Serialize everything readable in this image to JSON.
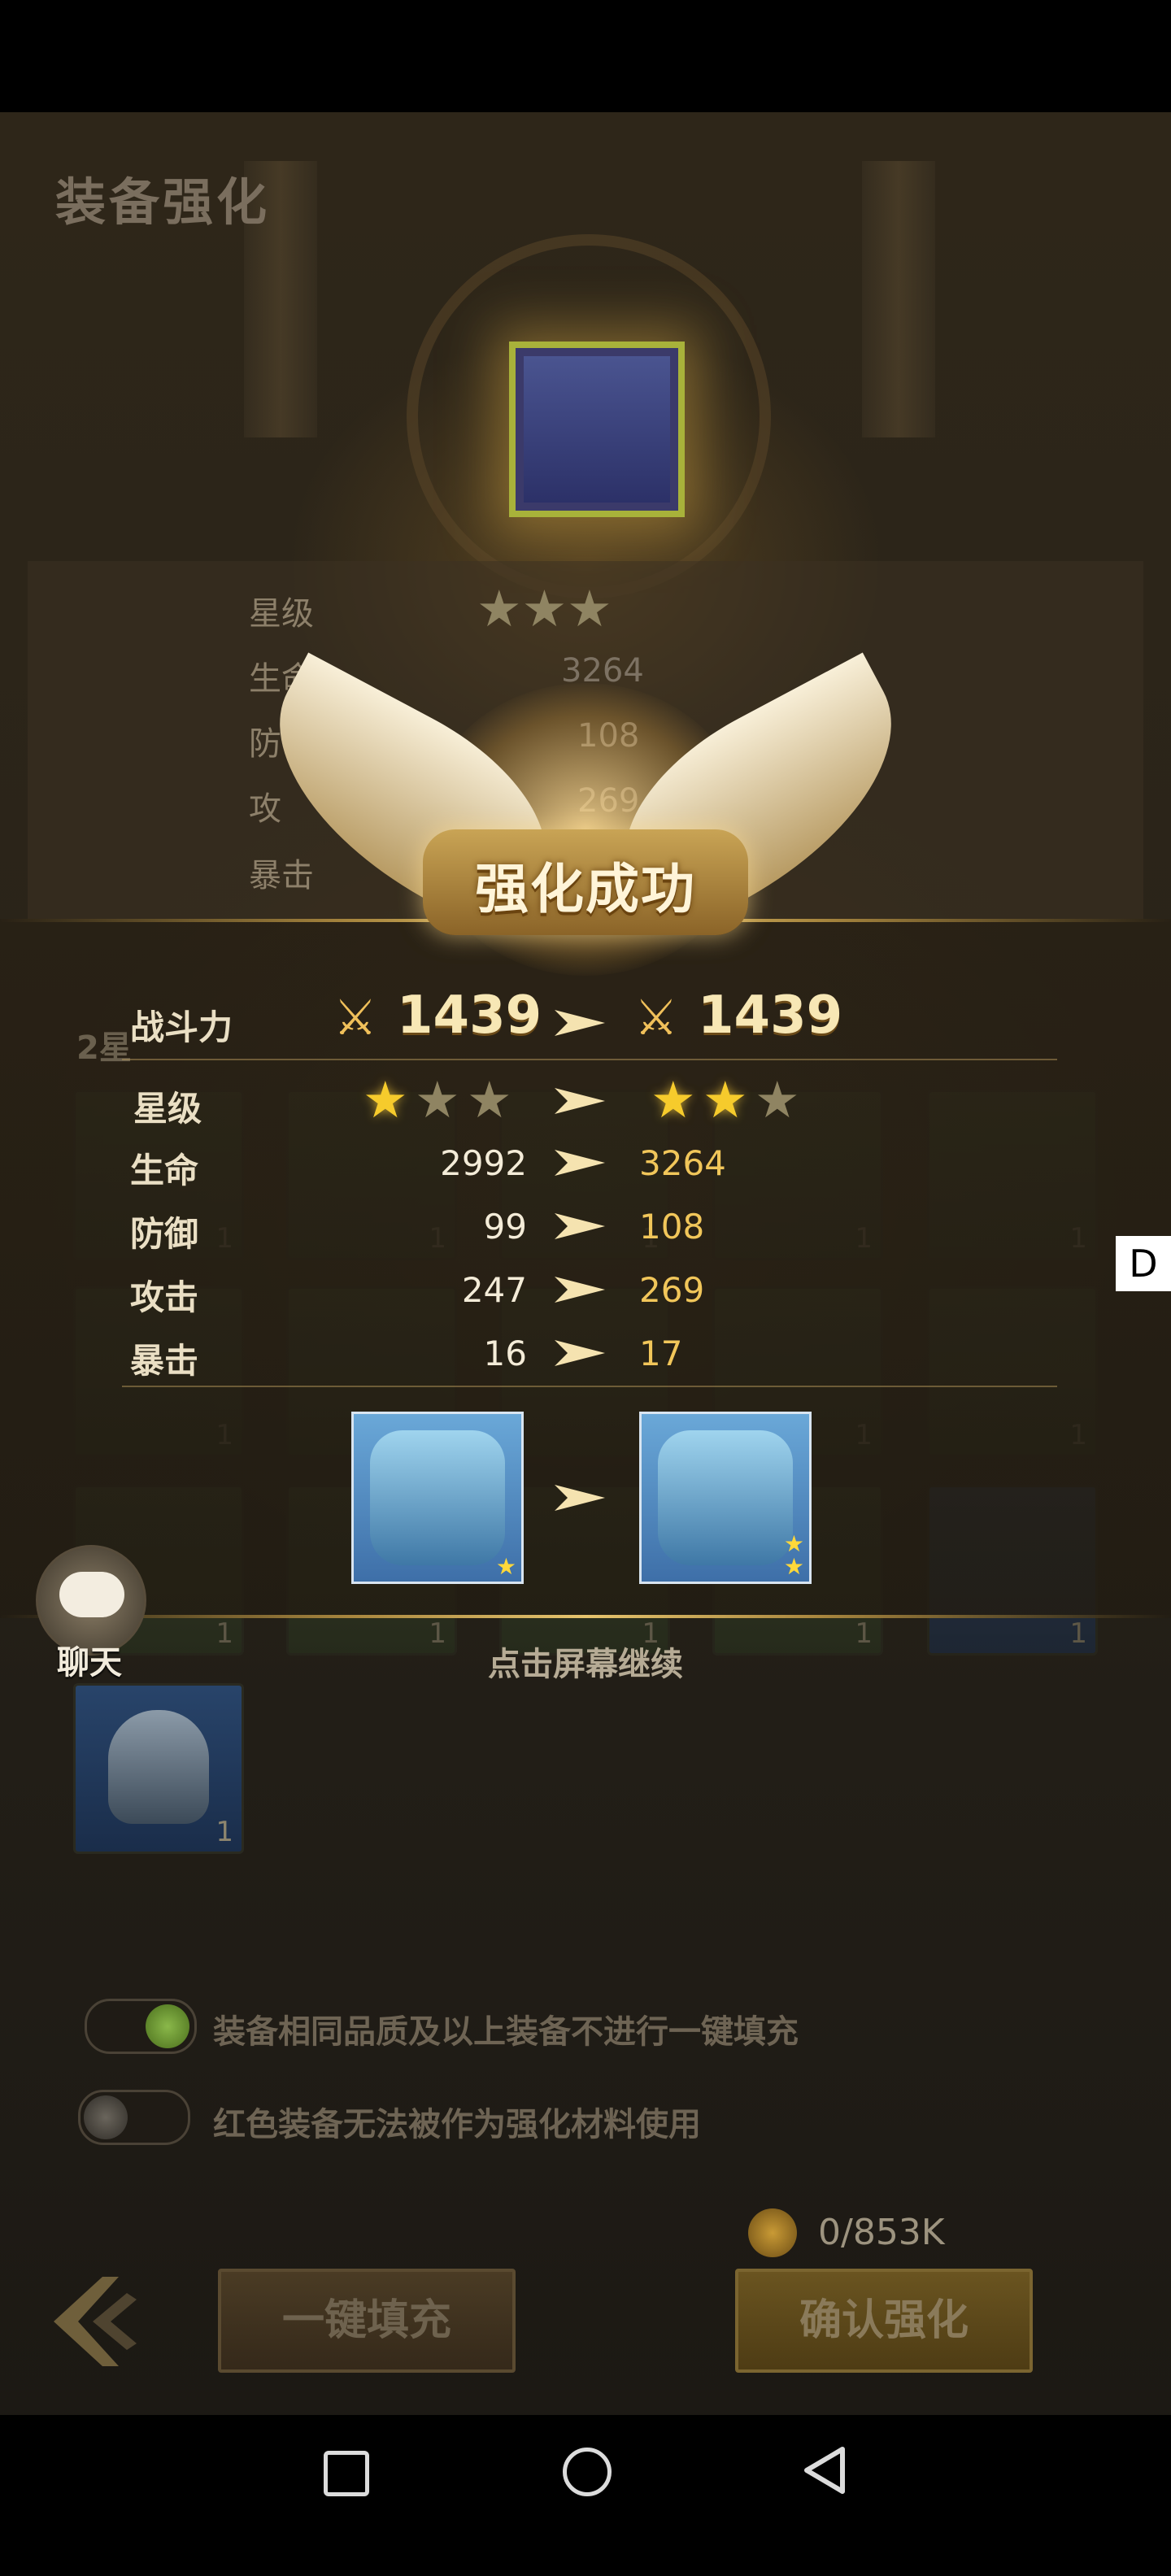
{
  "screen": {
    "title": "装备强化",
    "continue_hint": "点击屏幕继续",
    "side_badge": "D"
  },
  "background_stats": {
    "star_label": "星级",
    "hp_label": "生命",
    "hp_value": "3264",
    "def_label": "防御",
    "def_value": "108",
    "atk_label": "攻",
    "atk_value": "269",
    "crit_label": "暴击",
    "section_label": "2星"
  },
  "popup": {
    "title": "强化成功",
    "power_label": "战斗力",
    "power_before": "1439",
    "power_after": "1439",
    "star_label": "星级",
    "stars_before": 1,
    "stars_after": 2,
    "stars_total": 3,
    "stats": [
      {
        "label": "生命",
        "before": "2992",
        "after": "3264"
      },
      {
        "label": "防御",
        "before": "99",
        "after": "108"
      },
      {
        "label": "攻击",
        "before": "247",
        "after": "269"
      },
      {
        "label": "暴击",
        "before": "16",
        "after": "17"
      }
    ]
  },
  "grid": {
    "qty": "1"
  },
  "chat": {
    "label": "聊天"
  },
  "options": {
    "toggle1_text": "装备相同品质及以上装备不进行一键填充",
    "toggle1_on": true,
    "toggle2_text": "红色装备无法被作为强化材料使用",
    "toggle2_on": false
  },
  "bottom": {
    "fill_label": "一键填充",
    "confirm_label": "确认强化",
    "coin_text": "0/853K"
  },
  "colors": {
    "gold": "#f1c65a",
    "star_on": "#f6cb2c",
    "toggle_on": "#5f8a2a"
  }
}
